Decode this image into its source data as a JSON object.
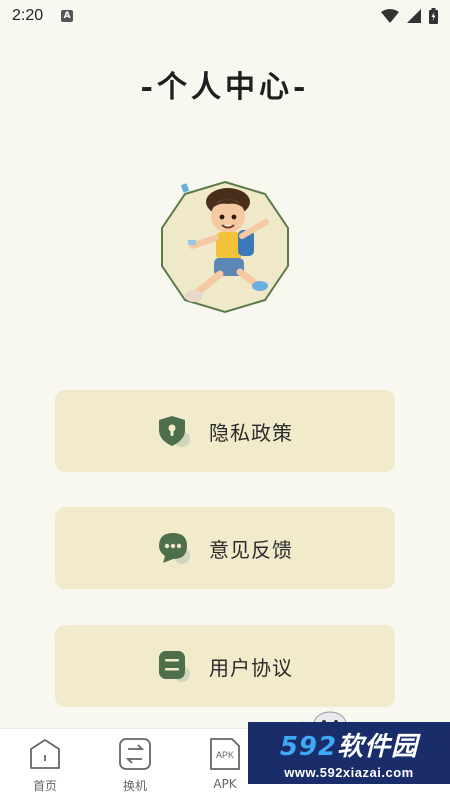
{
  "status_bar": {
    "time": "2:20",
    "notification_letter": "A"
  },
  "page_title": "-个人中心-",
  "menu": [
    {
      "label": "隐私政策",
      "icon": "shield-lock-icon"
    },
    {
      "label": "意见反馈",
      "icon": "chat-bubble-icon"
    },
    {
      "label": "用户协议",
      "icon": "document-lines-icon"
    }
  ],
  "bottom_nav": [
    {
      "label": "首页",
      "icon": "home-icon"
    },
    {
      "label": "换机",
      "icon": "transfer-icon"
    },
    {
      "label": "APK",
      "icon": "apk-file-icon"
    },
    {
      "label": "",
      "icon": "hidden-tab-icon"
    },
    {
      "label": "",
      "icon": "profile-tab-icon",
      "active": true
    }
  ],
  "watermark": {
    "brand_num": "592",
    "brand_text": "软件园",
    "url": "www.592xiazai.com"
  },
  "colors": {
    "background": "#f8f8f1",
    "card": "#f1ebcb",
    "accent_green": "#4a6b4a",
    "watermark_bg": "#1a2d6b"
  }
}
